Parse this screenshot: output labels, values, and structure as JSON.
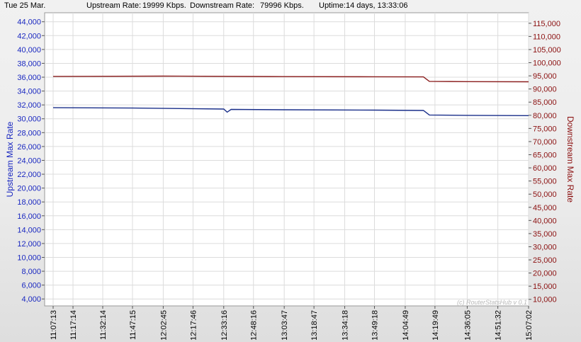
{
  "header": {
    "date": "Tue 25 Mar.",
    "upstream_label": "Upstream Rate:",
    "upstream_value": "19999 Kbps.",
    "downstream_label": "Downstream Rate:",
    "downstream_value": "79996 Kbps.",
    "uptime_label": "Uptime:",
    "uptime_value": "14 days, 13:33:06"
  },
  "colors": {
    "upstream": "#1a2f8a",
    "downstream": "#8b1e1e",
    "left_axis_text": "#1a28c0",
    "right_axis_text": "#8b1010",
    "grid": "#dcdcdc"
  },
  "watermark": "(c) RouterStatsHub v 0.1",
  "chart_data": {
    "type": "line",
    "grid": true,
    "xlabel": "",
    "x_ticks": [
      "11:07:13",
      "11:17:14",
      "11:32:14",
      "11:47:15",
      "12:02:45",
      "12:17:46",
      "12:33:16",
      "12:48:16",
      "13:03:47",
      "13:18:47",
      "13:34:18",
      "13:49:18",
      "14:04:49",
      "14:19:49",
      "14:36:05",
      "14:51:32",
      "15:07:02"
    ],
    "y_left": {
      "label": "Upstream Max Rate",
      "range": [
        3000,
        45300
      ],
      "ticks": [
        "4,000",
        "6,000",
        "8,000",
        "10,000",
        "12,000",
        "14,000",
        "16,000",
        "18,000",
        "20,000",
        "22,000",
        "24,000",
        "26,000",
        "28,000",
        "30,000",
        "32,000",
        "34,000",
        "36,000",
        "38,000",
        "40,000",
        "42,000",
        "44,000"
      ]
    },
    "y_right": {
      "label": "Downstream Max Rate",
      "range": [
        7500,
        119000
      ],
      "ticks": [
        "10,000",
        "15,000",
        "20,000",
        "25,000",
        "30,000",
        "35,000",
        "40,000",
        "45,000",
        "50,000",
        "55,000",
        "60,000",
        "65,000",
        "70,000",
        "75,000",
        "80,000",
        "85,000",
        "90,000",
        "95,000",
        "100,000",
        "105,000",
        "110,000",
        "115,000"
      ]
    },
    "series": [
      {
        "name": "Upstream Max Rate",
        "axis": "left",
        "points": [
          [
            "11:07:13",
            31600
          ],
          [
            "11:47:15",
            31550
          ],
          [
            "12:33:16",
            31400
          ],
          [
            "12:35:00",
            30950
          ],
          [
            "12:37:00",
            31350
          ],
          [
            "13:03:47",
            31300
          ],
          [
            "13:49:18",
            31250
          ],
          [
            "14:14:00",
            31200
          ],
          [
            "14:17:00",
            30550
          ],
          [
            "14:36:05",
            30500
          ],
          [
            "15:07:02",
            30450
          ]
        ]
      },
      {
        "name": "Downstream Max Rate",
        "axis": "right",
        "points": [
          [
            "11:07:13",
            94800
          ],
          [
            "12:02:45",
            94900
          ],
          [
            "13:03:47",
            94700
          ],
          [
            "13:49:18",
            94650
          ],
          [
            "14:14:00",
            94600
          ],
          [
            "14:17:00",
            92900
          ],
          [
            "14:36:05",
            92800
          ],
          [
            "15:07:02",
            92750
          ]
        ]
      }
    ]
  }
}
